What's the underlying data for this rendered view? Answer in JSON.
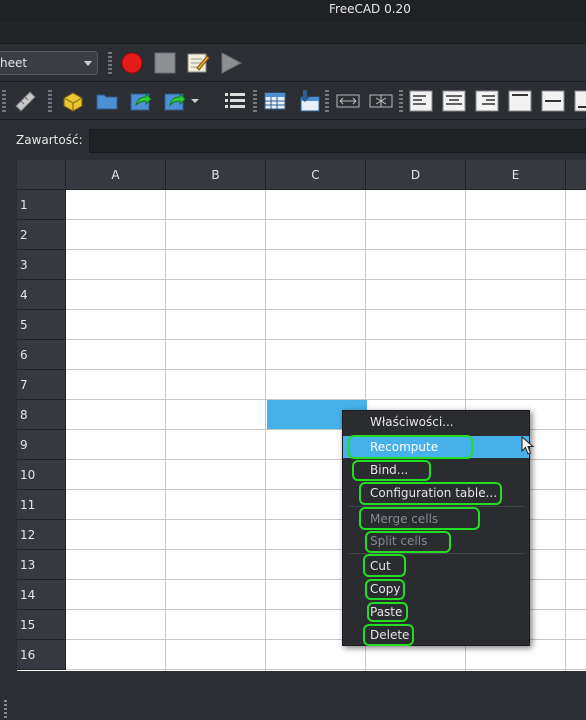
{
  "window": {
    "title": "FreeCAD 0.20"
  },
  "workbench": {
    "selected": "heet"
  },
  "toolbar1": {
    "macro_record": "record-macro-icon",
    "macro_stop": "stop-macro-icon",
    "macro_edit": "edit-macro-icon",
    "macro_run": "run-macro-icon"
  },
  "contents": {
    "label": "Zawartość:",
    "value": ""
  },
  "columns": [
    "A",
    "B",
    "C",
    "D",
    "E"
  ],
  "rows": [
    "1",
    "2",
    "3",
    "4",
    "5",
    "6",
    "7",
    "8",
    "9",
    "10",
    "11",
    "12",
    "13",
    "14",
    "15",
    "16"
  ],
  "context_menu": {
    "items": [
      {
        "label": "Właściwości...",
        "enabled": true,
        "highlighted": false
      },
      {
        "label": "Recompute",
        "enabled": true,
        "highlighted": true
      },
      {
        "label": "Bind...",
        "enabled": true,
        "highlighted": false
      },
      {
        "label": "Configuration table...",
        "enabled": true,
        "highlighted": false
      },
      {
        "label": "Merge cells",
        "enabled": false,
        "highlighted": false
      },
      {
        "label": "Split cells",
        "enabled": false,
        "highlighted": false
      },
      {
        "label": "Cut",
        "enabled": true,
        "highlighted": false
      },
      {
        "label": "Copy",
        "enabled": true,
        "highlighted": false
      },
      {
        "label": "Paste",
        "enabled": true,
        "highlighted": false
      },
      {
        "label": "Delete",
        "enabled": true,
        "highlighted": false
      }
    ]
  },
  "colors": {
    "selection": "#47b1ea",
    "highlight_box": "#22dd22",
    "record": "#e31b1b"
  }
}
